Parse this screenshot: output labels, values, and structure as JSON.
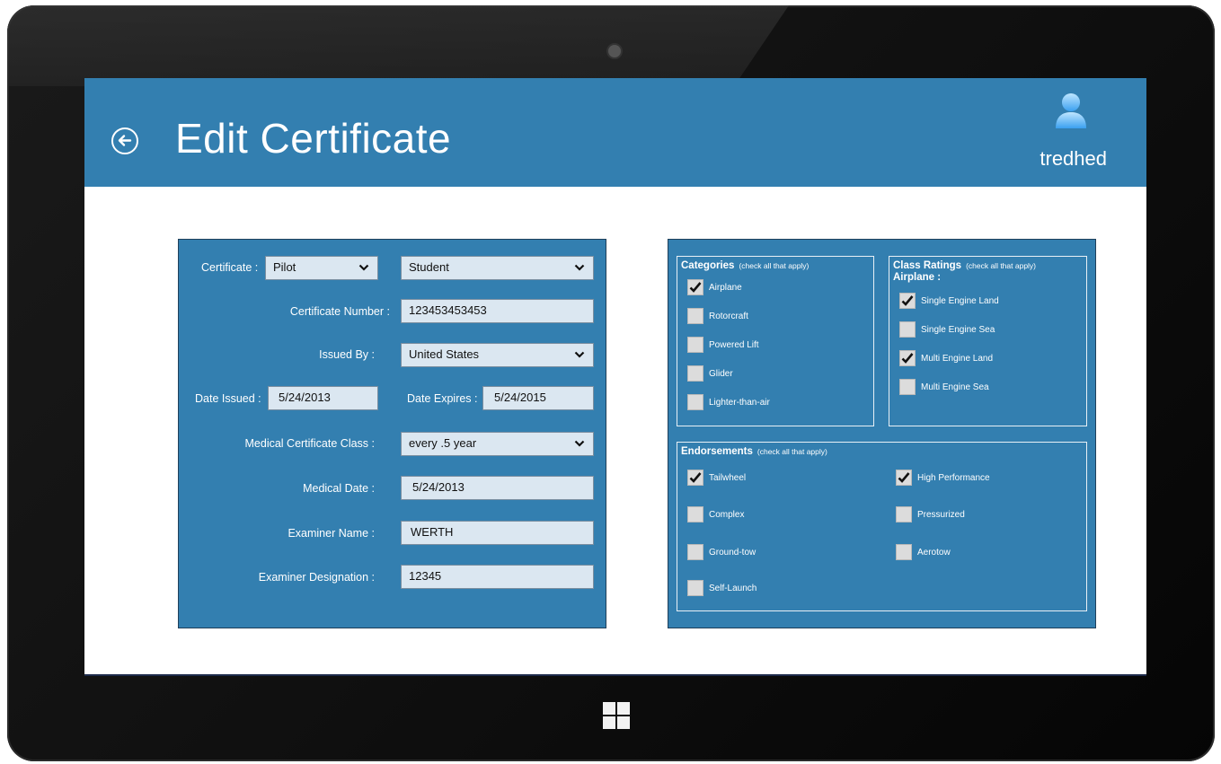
{
  "header": {
    "title": "Edit Certificate",
    "username": "tredhed",
    "back_icon": "back-arrow-icon",
    "avatar_icon": "user-avatar-icon",
    "bar_color": "#337fb0"
  },
  "form": {
    "certificate_label": "Certificate :",
    "certificate_type": "Pilot",
    "certificate_level": "Student",
    "certificate_number_label": "Certificate Number :",
    "certificate_number": "123453453453",
    "issued_by_label": "Issued By :",
    "issued_by": "United States",
    "date_issued_label": "Date Issued :",
    "date_issued": "5/24/2013",
    "date_expires_label": "Date Expires :",
    "date_expires": "5/24/2015",
    "medical_class_label": "Medical Certificate Class :",
    "medical_class": "every .5 year",
    "medical_date_label": "Medical Date :",
    "medical_date": "5/24/2013",
    "examiner_name_label": "Examiner Name :",
    "examiner_name": "WERTH",
    "examiner_designation_label": "Examiner Designation :",
    "examiner_designation": "12345"
  },
  "categories": {
    "title": "Categories",
    "hint": "(check all that apply)",
    "items": [
      {
        "label": "Airplane",
        "checked": true
      },
      {
        "label": "Rotorcraft",
        "checked": false
      },
      {
        "label": "Powered Lift",
        "checked": false
      },
      {
        "label": "Glider",
        "checked": false
      },
      {
        "label": "Lighter-than-air",
        "checked": false
      }
    ]
  },
  "class_ratings": {
    "title": "Class Ratings",
    "hint": "(check all that apply)",
    "subtitle": "Airplane :",
    "items": [
      {
        "label": "Single Engine Land",
        "checked": true
      },
      {
        "label": "Single Engine Sea",
        "checked": false
      },
      {
        "label": "Multi Engine Land",
        "checked": true
      },
      {
        "label": "Multi Engine Sea",
        "checked": false
      }
    ]
  },
  "endorsements": {
    "title": "Endorsements",
    "hint": "(check all that apply)",
    "items": [
      {
        "label": "Tailwheel",
        "checked": true
      },
      {
        "label": "High Performance",
        "checked": true
      },
      {
        "label": "Complex",
        "checked": false
      },
      {
        "label": "Pressurized",
        "checked": false
      },
      {
        "label": "Ground-tow",
        "checked": false
      },
      {
        "label": "Aerotow",
        "checked": false
      },
      {
        "label": "Self-Launch",
        "checked": false
      }
    ]
  }
}
